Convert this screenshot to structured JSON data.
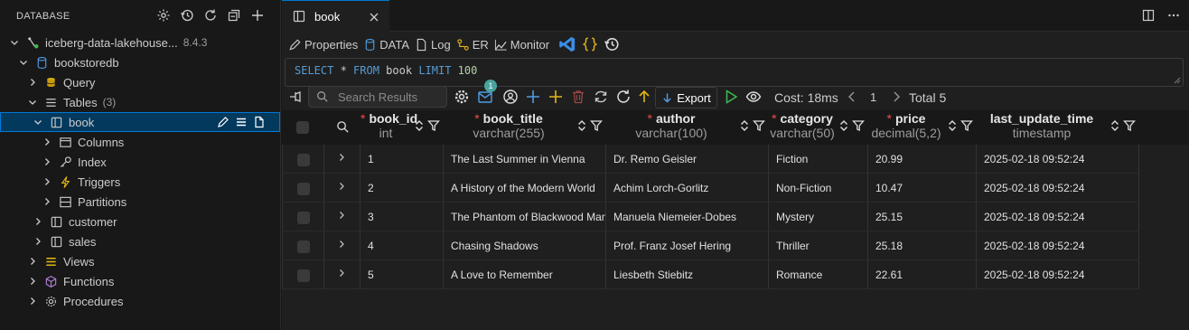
{
  "sidebar": {
    "title": "DATABASE",
    "connection": {
      "label": "iceberg-data-lakehouse...",
      "version": "8.4.3"
    },
    "database": "bookstoredb",
    "query": "Query",
    "tables": {
      "label": "Tables",
      "count": "(3)"
    },
    "book": "book",
    "book_children": [
      "Columns",
      "Index",
      "Triggers",
      "Partitions"
    ],
    "other_tables": [
      "customer",
      "sales"
    ],
    "views": "Views",
    "functions": "Functions",
    "procedures": "Procedures"
  },
  "tab": {
    "label": "book"
  },
  "toolbar": {
    "properties": "Properties",
    "data": "DATA",
    "log": "Log",
    "er": "ER",
    "monitor": "Monitor"
  },
  "sql": {
    "select": "SELECT",
    "star": " * ",
    "from": "FROM",
    "table": " book ",
    "limit": "LIMIT",
    "n": " 100"
  },
  "results": {
    "search_placeholder": "Search Results",
    "badge": "1",
    "export": "Export",
    "cost": "Cost: 18ms",
    "page": "1",
    "total": "Total 5"
  },
  "columns": [
    {
      "name": "book_id",
      "type": "int",
      "required": true
    },
    {
      "name": "book_title",
      "type": "varchar(255)",
      "required": true
    },
    {
      "name": "author",
      "type": "varchar(100)",
      "required": true
    },
    {
      "name": "category",
      "type": "varchar(50)",
      "required": true
    },
    {
      "name": "price",
      "type": "decimal(5,2)",
      "required": true
    },
    {
      "name": "last_update_time",
      "type": "timestamp",
      "required": false
    }
  ],
  "rows": [
    [
      "1",
      "The Last Summer in Vienna",
      "Dr. Remo Geisler",
      "Fiction",
      "20.99",
      "2025-02-18 09:52:24"
    ],
    [
      "2",
      "A History of the Modern World",
      "Achim Lorch-Gorlitz",
      "Non-Fiction",
      "10.47",
      "2025-02-18 09:52:24"
    ],
    [
      "3",
      "The Phantom of Blackwood Manor",
      "Manuela Niemeier-Dobes",
      "Mystery",
      "25.15",
      "2025-02-18 09:52:24"
    ],
    [
      "4",
      "Chasing Shadows",
      "Prof. Franz Josef Hering",
      "Thriller",
      "25.18",
      "2025-02-18 09:52:24"
    ],
    [
      "5",
      "A Love to Remember",
      "Liesbeth Stiebitz",
      "Romance",
      "22.61",
      "2025-02-18 09:52:24"
    ]
  ],
  "colors": {
    "accent": "#0078d4",
    "selected_bg": "#04395e",
    "required": "#f14c4c",
    "folder": "#dcb67a"
  }
}
